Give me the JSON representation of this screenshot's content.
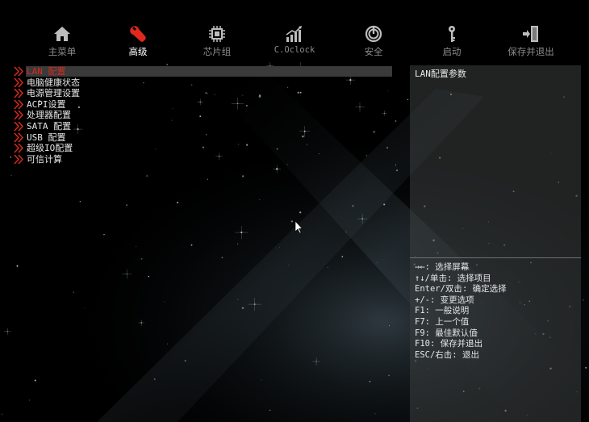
{
  "nav": {
    "items": [
      {
        "label": "主菜单",
        "icon": "home-icon",
        "active": false
      },
      {
        "label": "高级",
        "icon": "wrench-icon",
        "active": true
      },
      {
        "label": "芯片组",
        "icon": "chip-icon",
        "active": false
      },
      {
        "label": "C.Oclock",
        "icon": "performance-chart-icon",
        "active": false
      },
      {
        "label": "安全",
        "icon": "power-icon",
        "active": false
      },
      {
        "label": "启动",
        "icon": "key-icon",
        "active": false
      },
      {
        "label": "保存并退出",
        "icon": "exit-door-icon",
        "active": false
      }
    ]
  },
  "menu": {
    "items": [
      {
        "label": "LAN 配置",
        "selected": true
      },
      {
        "label": "电脑健康状态",
        "selected": false
      },
      {
        "label": "电源管理设置",
        "selected": false
      },
      {
        "label": "ACPI设置",
        "selected": false
      },
      {
        "label": "处理器配置",
        "selected": false
      },
      {
        "label": "SATA 配置",
        "selected": false
      },
      {
        "label": "USB 配置",
        "selected": false
      },
      {
        "label": "超级IO配置",
        "selected": false
      },
      {
        "label": "可信计算",
        "selected": false
      }
    ]
  },
  "help": {
    "title": "LAN配置参数",
    "keys": [
      {
        "key": "→←",
        "desc": ": 选择屏幕"
      },
      {
        "key": "↑↓/单击",
        "desc": ": 选择项目"
      },
      {
        "key": "Enter/双击",
        "desc": ": 确定选择"
      },
      {
        "key": "+/-",
        "desc": ": 变更选项"
      },
      {
        "key": "F1",
        "desc": ": 一般说明"
      },
      {
        "key": "F7",
        "desc": ": 上一个值"
      },
      {
        "key": "F9",
        "desc": ": 最佳默认值"
      },
      {
        "key": "F10",
        "desc": ": 保存并退出"
      },
      {
        "key": "ESC/右击",
        "desc": ": 退出"
      }
    ]
  },
  "colors": {
    "accent": "#d52a1e",
    "background": "#000000",
    "panel": "#3c3f40",
    "text": "#e6e6e6",
    "nav_inactive": "#8a8a8a"
  }
}
